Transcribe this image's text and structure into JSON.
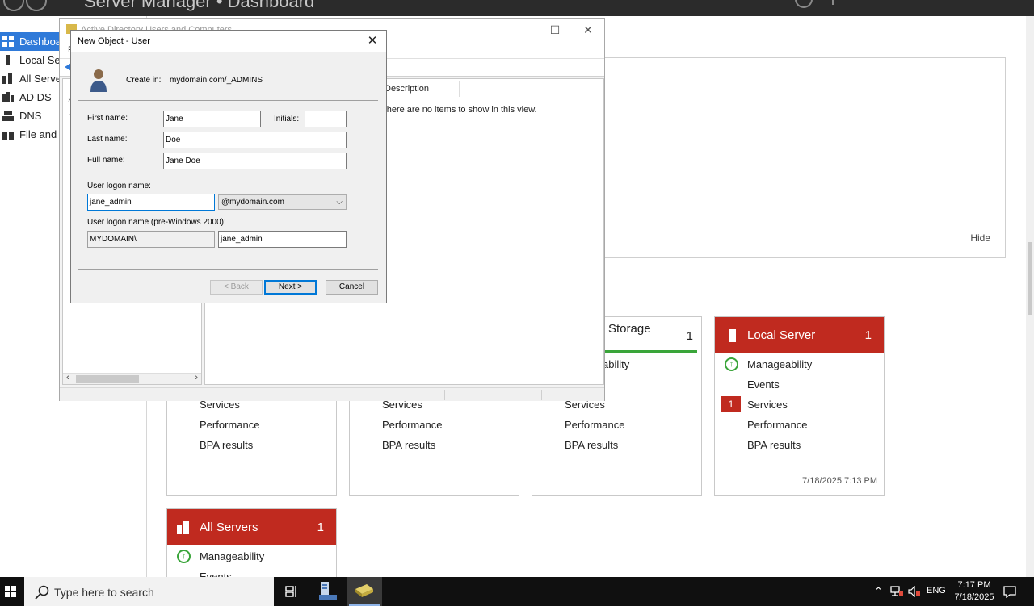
{
  "server_manager": {
    "title": "Server Manager • Dashboard",
    "sidebar": [
      {
        "label": "Dashboard",
        "active": true
      },
      {
        "label": "Local Server",
        "active": false
      },
      {
        "label": "All Servers",
        "active": false
      },
      {
        "label": "AD DS",
        "active": false
      },
      {
        "label": "DNS",
        "active": false
      },
      {
        "label": "File and Storage Services",
        "active": false
      }
    ],
    "welcome_hide": "Hide",
    "tiles": {
      "col1": {
        "rows": [
          "Services",
          "Performance",
          "BPA results"
        ]
      },
      "col2": {
        "rows": [
          "Services",
          "Performance",
          "BPA results"
        ]
      },
      "storage": {
        "title": "Storage",
        "title_overflow": "s",
        "count": "1",
        "rows": [
          "Manageability",
          "Services",
          "Performance",
          "BPA results"
        ]
      },
      "local_server": {
        "title": "Local Server",
        "count": "1",
        "rows": [
          "Manageability",
          "Events",
          "Services",
          "Performance",
          "BPA results"
        ],
        "services_badge": "1",
        "timestamp": "7/18/2025 7:13 PM"
      },
      "all_servers": {
        "title": "All Servers",
        "count": "1",
        "rows": [
          "Manageability",
          "Events"
        ]
      }
    },
    "colors": {
      "tile_red": "#c02a1f",
      "accent_blue": "#2f7ad9",
      "ok_green": "#3aa53a"
    }
  },
  "aduc": {
    "title": "Active Directory Users and Computers",
    "menu_first_letter": "F",
    "list_column": "Description",
    "empty_message": "There are no items to show in this view."
  },
  "dialog": {
    "title": "New Object - User",
    "create_in_label": "Create in:",
    "create_in_value": "mydomain.com/_ADMINS",
    "first_name_label": "First name:",
    "first_name_value": "Jane",
    "initials_label": "Initials:",
    "initials_value": "",
    "last_name_label": "Last name:",
    "last_name_value": "Doe",
    "full_name_label": "Full name:",
    "full_name_value": "Jane Doe",
    "logon_label": "User logon name:",
    "logon_value": "jane_admin",
    "domain_suffix": "@mydomain.com",
    "pre2000_label": "User logon name (pre-Windows 2000):",
    "pre2000_domain": "MYDOMAIN\\",
    "pre2000_value": "jane_admin",
    "back_button": "< Back",
    "next_button": "Next >",
    "cancel_button": "Cancel"
  },
  "taskbar": {
    "search_placeholder": "Type here to search",
    "language": "ENG",
    "time": "7:17 PM",
    "date": "7/18/2025"
  }
}
